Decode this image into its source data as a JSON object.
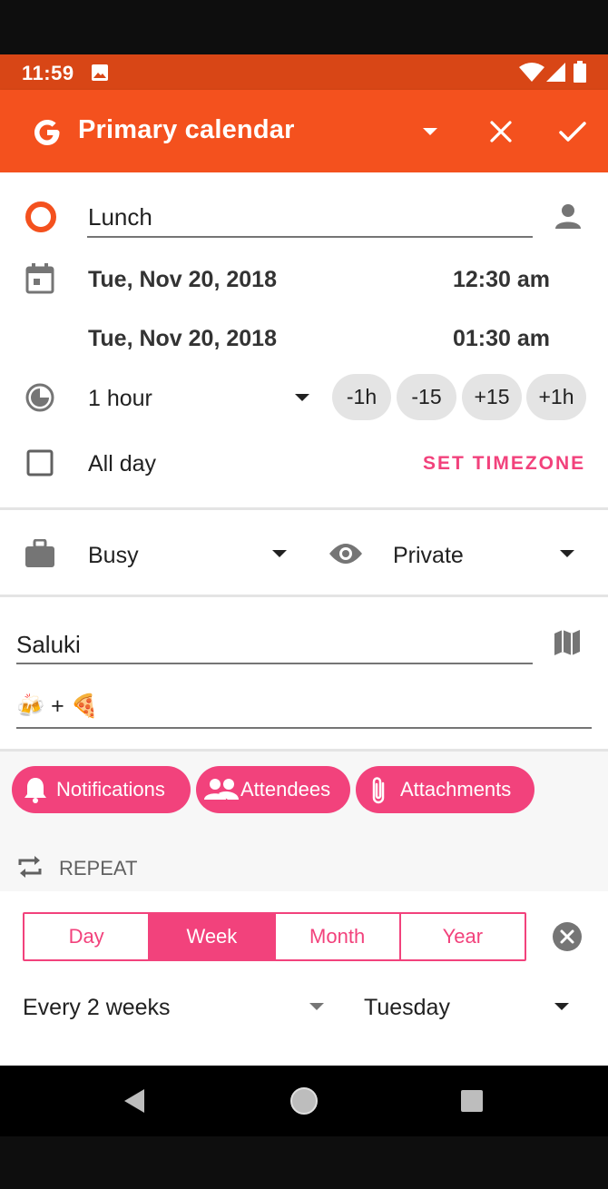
{
  "status_bar": {
    "time": "11:59"
  },
  "toolbar": {
    "calendar_name": "Primary calendar"
  },
  "event": {
    "title": "Lunch",
    "start_date": "Tue, Nov 20, 2018",
    "start_time": "12:30 am",
    "end_date": "Tue, Nov 20, 2018",
    "end_time": "01:30 am",
    "duration": "1 hour",
    "adjust_buttons": [
      "-1h",
      "-15",
      "+15",
      "+1h"
    ],
    "all_day_label": "All day",
    "set_timezone_label": "SET TIMEZONE",
    "availability": "Busy",
    "visibility": "Private",
    "location": "Saluki",
    "description": "🍻 + 🍕"
  },
  "chips": {
    "notifications": "Notifications",
    "attendees": "Attendees",
    "attachments": "Attachments"
  },
  "repeat": {
    "header": "REPEAT",
    "units": [
      "Day",
      "Week",
      "Month",
      "Year"
    ],
    "selected_unit": "Week",
    "interval": "Every 2 weeks",
    "weekday": "Tuesday"
  },
  "colors": {
    "accent": "#f2427c",
    "toolbar": "#f4511e",
    "status_bar": "#d84616",
    "event_color": "#f4511e"
  }
}
